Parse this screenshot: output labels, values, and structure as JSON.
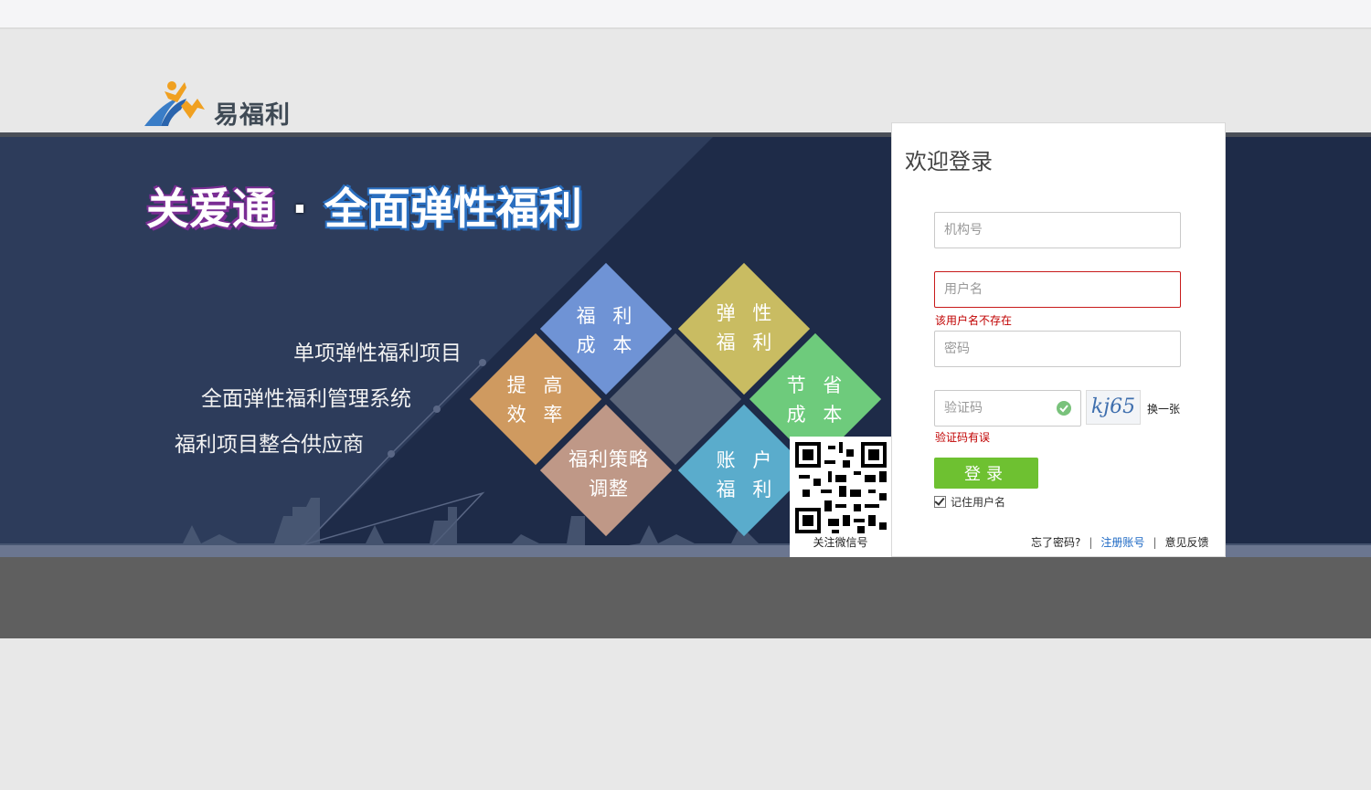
{
  "logo": {
    "text": "易福利"
  },
  "banner": {
    "headline_left": "关爱通",
    "headline_dot": "·",
    "headline_right": "全面弹性福利",
    "taglines": [
      "单项弹性福利项目",
      "全面弹性福利管理系统",
      "福利项目整合供应商"
    ],
    "tiles": [
      {
        "text": "福 利\n成 本",
        "color": "#6f93d5"
      },
      {
        "text": "弹 性\n福 利",
        "color": "#c9bc62"
      },
      {
        "text": "提 高\n效 率",
        "color": "#cf9a60"
      },
      {
        "text": "",
        "color": "#5b6579"
      },
      {
        "text": "节 省\n成 本",
        "color": "#6ecb7c"
      },
      {
        "text": "福利策略\n调整",
        "color": "#bf9887"
      },
      {
        "text": "账 户\n福 利",
        "color": "#5aaccc"
      }
    ],
    "qr_label": "关注微信号"
  },
  "login": {
    "title": "欢迎登录",
    "org_placeholder": "机构号",
    "username_placeholder": "用户名",
    "username_error": "该用户名不存在",
    "password_placeholder": "密码",
    "captcha_placeholder": "验证码",
    "captcha_image_text": "kj65",
    "captcha_refresh": "换一张",
    "captcha_error": "验证码有误",
    "submit_label": "登录",
    "remember_label": "记住用户名",
    "forgot_label": "忘了密码?",
    "register_label": "注册账号",
    "feedback_label": "意见反馈",
    "colors": {
      "error": "#c00000",
      "button": "#6ec131",
      "link": "#1c68c4"
    }
  }
}
